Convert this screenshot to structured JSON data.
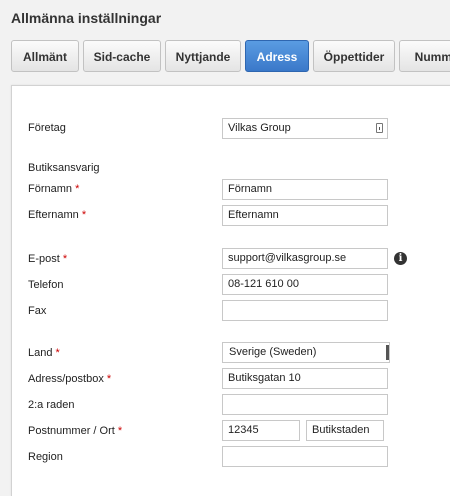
{
  "page": {
    "title": "Allmänna inställningar"
  },
  "tabs": [
    {
      "label": "Allmänt"
    },
    {
      "label": "Sid-cache"
    },
    {
      "label": "Nyttjande"
    },
    {
      "label": "Adress"
    },
    {
      "label": "Öppettider"
    },
    {
      "label": "Nummer"
    }
  ],
  "tabs_active_index": 3,
  "form": {
    "company": {
      "label": "Företag",
      "value": "Vilkas Group"
    },
    "section_contact": "Butiksansvarig",
    "first_name": {
      "label": "Förnamn",
      "required": "*",
      "value": "Förnamn"
    },
    "last_name": {
      "label": "Efternamn",
      "required": "*",
      "value": "Efternamn"
    },
    "email": {
      "label": "E-post",
      "required": "*",
      "value": "support@vilkasgroup.se"
    },
    "phone": {
      "label": "Telefon",
      "value": "08-121 610 00"
    },
    "fax": {
      "label": "Fax",
      "value": ""
    },
    "country": {
      "label": "Land",
      "required": "*",
      "selected": "Sverige (Sweden)"
    },
    "address": {
      "label": "Adress/postbox",
      "required": "*",
      "value": "Butiksgatan 10"
    },
    "address2": {
      "label": "2:a raden",
      "value": ""
    },
    "postal": {
      "label": "Postnummer / Ort",
      "required": "*",
      "postcode": "12345",
      "city": "Butikstaden"
    },
    "region": {
      "label": "Region",
      "value": ""
    }
  },
  "icons": {
    "info": "info-icon",
    "field_menu": "contact-card-icon"
  },
  "colors": {
    "active_tab": "#4a8ad6",
    "required": "#cc0000"
  }
}
